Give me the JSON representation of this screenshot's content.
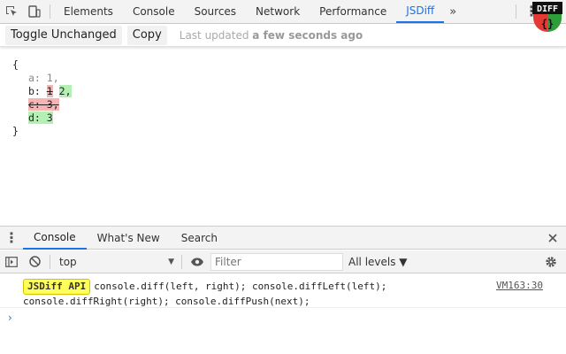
{
  "devtools": {
    "tabs": [
      "Elements",
      "Console",
      "Sources",
      "Network",
      "Performance",
      "JSDiff"
    ],
    "more": "»"
  },
  "jsdiff": {
    "toggle_label": "Toggle Unchanged",
    "copy_label": "Copy",
    "updated_prefix": "Last updated ",
    "updated_rel": "a few seconds ago",
    "logo_text": "DIFF",
    "logo_brace": "{}",
    "diff": {
      "open": "{",
      "close": "}",
      "a_line": "a: 1,",
      "b_key": "b: ",
      "b_old": "1",
      "b_new": "2,",
      "c_removed": "c: 3,",
      "d_added": "d: 3"
    }
  },
  "drawer": {
    "tabs": [
      "Console",
      "What's New",
      "Search"
    ]
  },
  "console_toolbar": {
    "context": "top",
    "filter_placeholder": "Filter",
    "levels": "All levels ▼"
  },
  "message": {
    "badge": "JSDiff API",
    "line1": "console.diff(left, right); console.diffLeft(left);",
    "line2": "console.diffRight(right); console.diffPush(next);",
    "source": "VM163:30"
  },
  "prompt_symbol": "›",
  "colors": {
    "accent": "#1a73e8",
    "removed": "#f8b4b4",
    "added": "#b4f0b4",
    "badge": "#ffff5c"
  }
}
